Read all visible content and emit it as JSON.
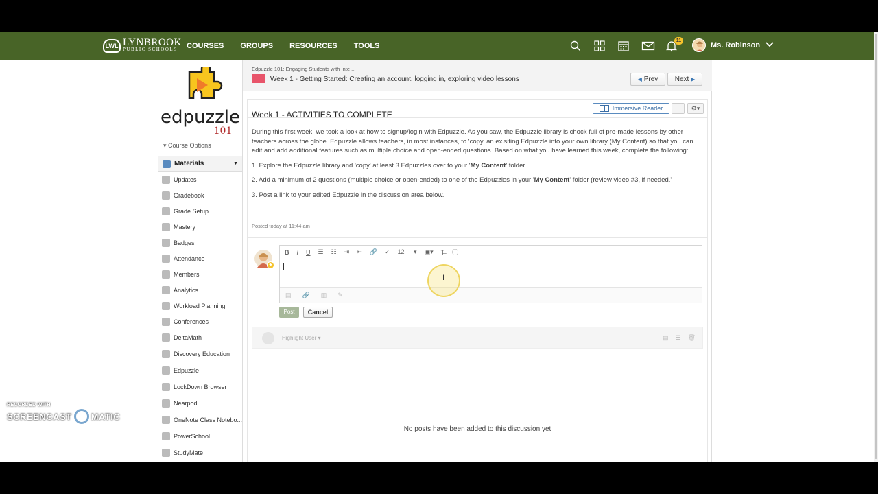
{
  "nav": {
    "logo_line1": "LYNBROOK",
    "logo_line2": "PUBLIC SCHOOLS",
    "logo_badge": "LWL",
    "links": [
      "COURSES",
      "GROUPS",
      "RESOURCES",
      "TOOLS"
    ],
    "notification_count": "11",
    "user_name": "Ms. Robinson"
  },
  "sidebar": {
    "logo_word": "edpuzzle",
    "logo_number": "101",
    "course_options": "Course Options",
    "items": [
      {
        "label": "Materials"
      },
      {
        "label": "Updates"
      },
      {
        "label": "Gradebook"
      },
      {
        "label": "Grade Setup"
      },
      {
        "label": "Mastery"
      },
      {
        "label": "Badges"
      },
      {
        "label": "Attendance"
      },
      {
        "label": "Members"
      },
      {
        "label": "Analytics"
      },
      {
        "label": "Workload Planning"
      },
      {
        "label": "Conferences"
      },
      {
        "label": "DeltaMath"
      },
      {
        "label": "Discovery Education"
      },
      {
        "label": "Edpuzzle"
      },
      {
        "label": "LockDown Browser"
      },
      {
        "label": "Nearpod"
      },
      {
        "label": "OneNote Class Notebo..."
      },
      {
        "label": "PowerSchool"
      },
      {
        "label": "StudyMate"
      }
    ]
  },
  "header": {
    "breadcrumb": "Edpuzzle 101: Engaging Students with Inte ...",
    "folder_title": "Week 1 - Getting Started: Creating an account, logging in, exploring video lessons",
    "prev_label": "Prev",
    "next_label": "Next"
  },
  "discussion": {
    "title": "Week 1 - ACTIVITIES TO COMPLETE",
    "immersive_reader": "Immersive Reader",
    "intro": "During this first week, we took a look at how to signup/login with Edpuzzle.  As you saw, the Edpuzzle library is chock full of pre-made lessons by other teachers across the globe.  Edpuzzle allows teachers, in most instances, to 'copy' an exisiting Edpuzzle into your own library (My Content) so that you can edit and add additional features such as multiple choice and open-ended questions.  Based on what you have learned this week, complete the following:",
    "step1_pre": "1.  Explore the Edpuzzle library and 'copy' at least 3 Edpuzzles over to your '",
    "step1_bold": "My Content",
    "step1_post": "' folder.",
    "step2_pre": "2.  Add a minimum of 2 questions (multiple choice or open-ended) to one of the Edpuzzles in your '",
    "step2_bold": "My Content",
    "step2_post": "' folder (review video #3, if needed.'",
    "step3": "3. Post a link to your edited Edpuzzle in the discussion area below.",
    "posted": "Posted today at 11:44 am"
  },
  "editor": {
    "font_size": "12",
    "post_label": "Post",
    "cancel_label": "Cancel"
  },
  "thread": {
    "highlight_user": "Highlight User",
    "empty_message": "No posts have been added to this discussion yet"
  },
  "watermark": {
    "line1": "RECORDED WITH",
    "line2a": "SCREENCAST",
    "line2b": "MATIC"
  },
  "colors": {
    "nav_bg": "#486427",
    "accent_blue": "#3b6ea5",
    "folder_pink": "#e8546a",
    "badge_yellow": "#f5c32c"
  }
}
